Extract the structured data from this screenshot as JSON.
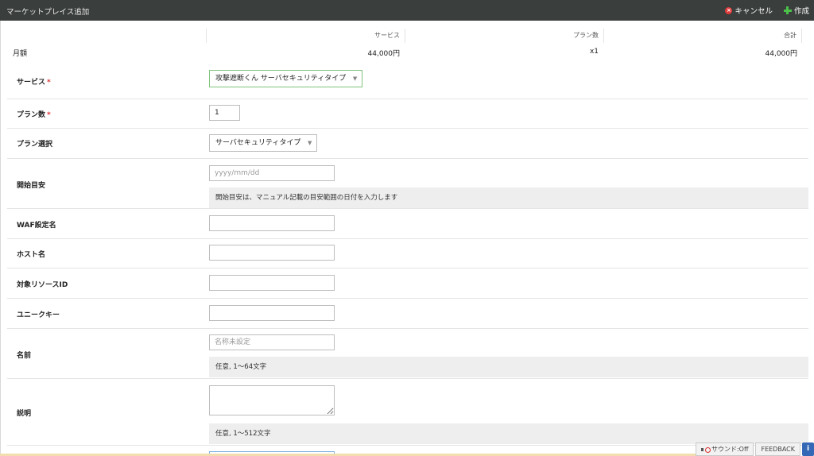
{
  "header": {
    "title": "マーケットプレイス追加",
    "cancel_label": "キャンセル",
    "create_label": "作成"
  },
  "summary": {
    "headers": {
      "service": "サービス",
      "plans": "プラン数",
      "total": "合計"
    },
    "row": {
      "label": "月額",
      "service": "44,000円",
      "plans": "x1",
      "total": "44,000円"
    }
  },
  "form": {
    "service": {
      "label": "サービス",
      "value": "攻撃遮断くん サーバセキュリティタイプ"
    },
    "plan_count": {
      "label": "プラン数",
      "value": "1"
    },
    "plan_select": {
      "label": "プラン選択",
      "value": "サーバセキュリティタイプ"
    },
    "start": {
      "label": "開始目安",
      "placeholder": "yyyy/mm/dd",
      "hint": "開始目安は、マニュアル記載の目安範囲の日付を入力します"
    },
    "waf": {
      "label": "WAF設定名"
    },
    "host": {
      "label": "ホスト名"
    },
    "resource_id": {
      "label": "対象リソースID"
    },
    "unique_key": {
      "label": "ユニークキー"
    },
    "name": {
      "label": "名前",
      "placeholder": "名称未設定",
      "hint": "任意, 1〜64文字"
    },
    "description": {
      "label": "説明",
      "hint": "任意, 1〜512文字"
    },
    "required_mark": "*"
  },
  "footer": {
    "sound_label": "サウンド:Off",
    "feedback_label": "FEEDBACK",
    "info_label": "i"
  }
}
